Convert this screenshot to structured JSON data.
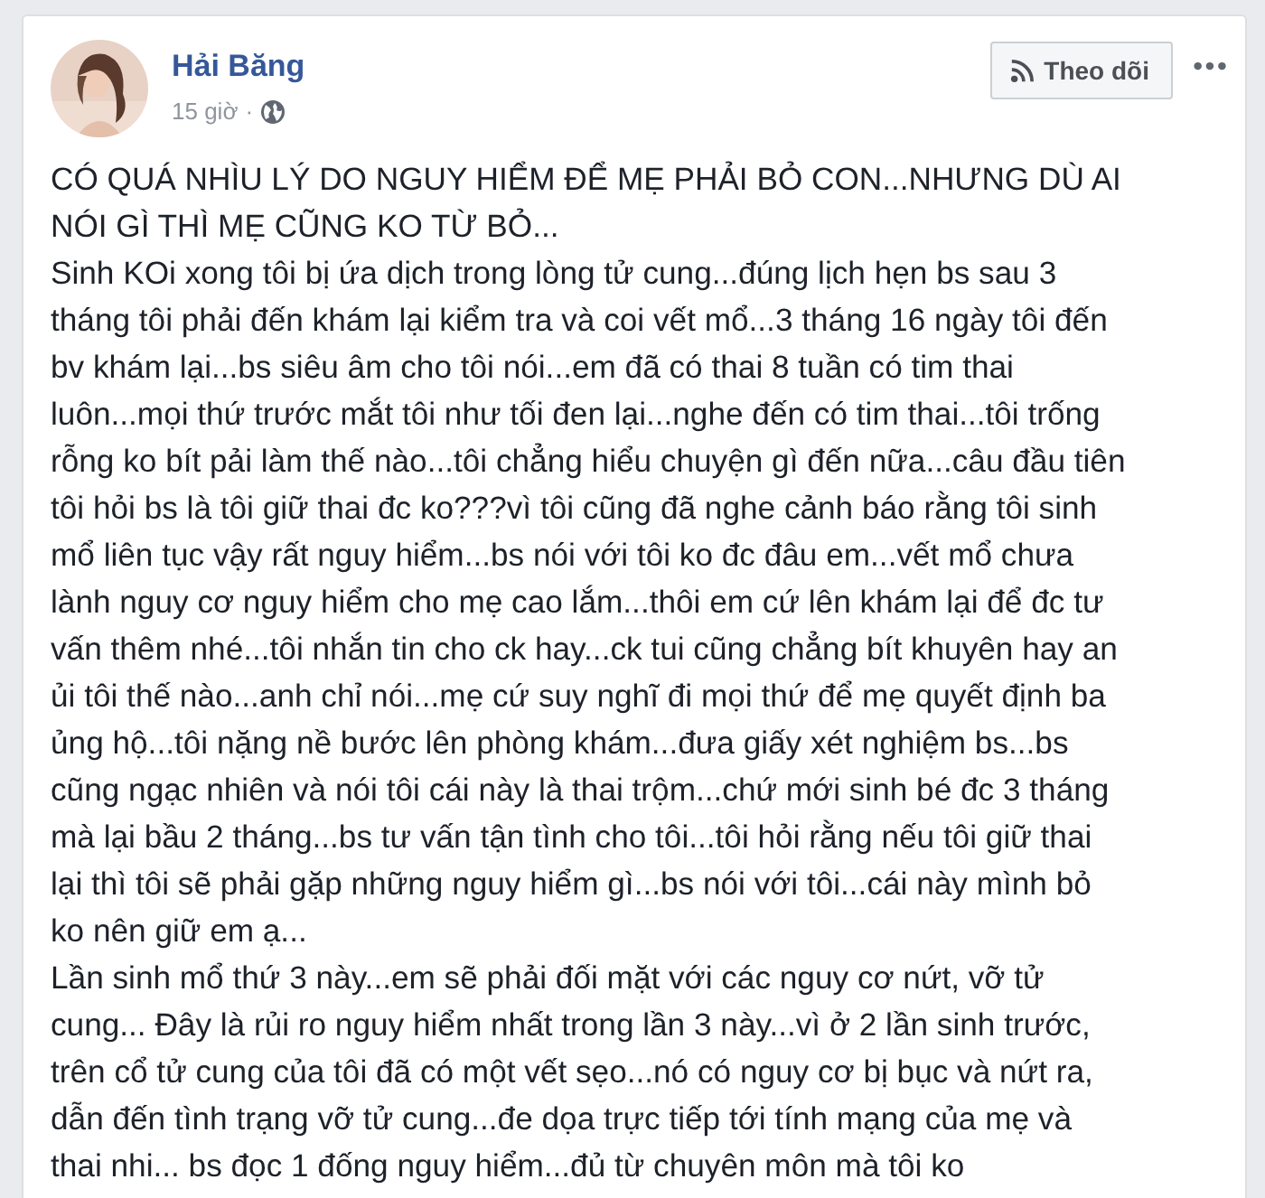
{
  "post": {
    "author": "Hải Băng",
    "time": "15 giờ",
    "separator": "·",
    "follow_button": "Theo dõi",
    "more": "•••",
    "paragraphs": [
      [
        "CÓ QUÁ NHÌU LÝ DO NGUY HIỂM ĐỂ MẸ PHẢI BỎ CON...NHƯNG DÙ AI",
        "NÓI GÌ THÌ MẸ CŨNG KO TỪ BỎ..."
      ],
      [
        "Sinh KOi xong tôi bị ứa dịch trong lòng tử cung...đúng lịch hẹn bs sau 3",
        "tháng tôi phải đến khám lại kiểm tra và coi vết mổ...3 tháng 16 ngày tôi đến",
        "bv khám lại...bs siêu âm cho tôi nói...em đã có thai 8 tuần có tim thai",
        "luôn...mọi thứ trước mắt tôi như tối đen lại...nghe đến có tim thai...tôi trống",
        "rỗng ko bít pải làm thế nào...tôi chẳng hiểu chuyện gì đến nữa...câu đầu tiên",
        "tôi hỏi bs là tôi giữ thai đc ko???vì tôi cũng đã nghe cảnh báo rằng tôi sinh",
        "mổ liên tục vậy rất nguy hiểm...bs nói với tôi ko đc đâu em...vết mổ chưa",
        "lành nguy cơ nguy hiểm cho mẹ cao lắm...thôi em cứ lên khám lại để đc tư",
        "vấn thêm nhé...tôi nhắn tin cho ck hay...ck tui cũng chẳng bít khuyên hay an",
        "ủi tôi thế nào...anh chỉ nói...mẹ cứ suy nghĩ đi mọi thứ để mẹ quyết định ba",
        "ủng hộ...tôi nặng nề bước lên phòng khám...đưa giấy xét nghiệm bs...bs",
        "cũng ngạc nhiên và nói tôi cái này là thai trộm...chứ mới sinh bé đc 3 tháng",
        "mà lại bầu 2 tháng...bs tư vấn tận tình cho tôi...tôi hỏi rằng nếu tôi giữ thai",
        "lại thì tôi sẽ phải gặp những nguy hiểm gì...bs nói với tôi...cái này mình bỏ",
        "ko nên giữ em ạ..."
      ],
      [
        "Lần sinh mổ thứ 3 này...em sẽ phải đối mặt với các nguy cơ nứt, vỡ tử",
        "cung... Đây là rủi ro nguy hiểm nhất trong lần 3 này...vì ở 2 lần sinh trước,",
        "trên cổ tử cung của tôi đã có một vết sẹo...nó có nguy cơ bị bục và nứt ra,",
        "dẫn đến tình trạng vỡ tử cung...đe dọa trực tiếp tới tính mạng của mẹ và",
        "thai nhi... bs đọc 1 đống nguy hiểm...đủ từ chuyên môn mà tôi ko"
      ]
    ]
  }
}
